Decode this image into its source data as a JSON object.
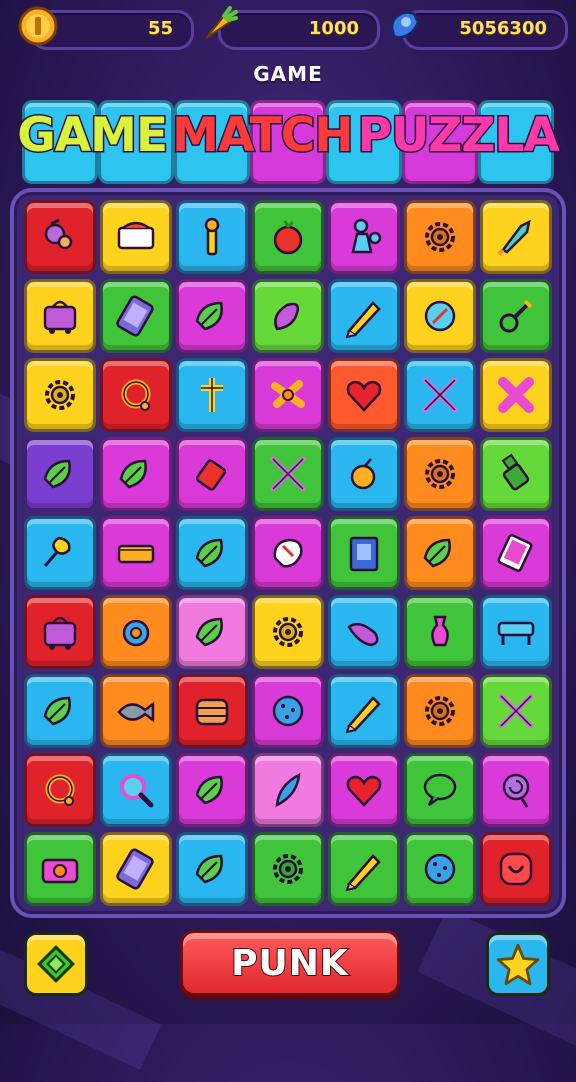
{
  "resources": [
    {
      "icon": "coin-icon",
      "value": "55"
    },
    {
      "icon": "carrot-icon",
      "value": "1000"
    },
    {
      "icon": "gem-icon",
      "value": "5056300"
    }
  ],
  "header": {
    "subtitle": "GAME"
  },
  "title": {
    "words": [
      {
        "text": "GAME",
        "color": "#d9f23a"
      },
      {
        "text": "MATCH",
        "color": "#ff3a3a"
      },
      {
        "text": "PUZZLA",
        "color": "#ff3aa8"
      }
    ]
  },
  "banner_colors": [
    "#2ec4f0",
    "#2ec4f0",
    "#2ec4f0",
    "#d63adb",
    "#2ec4f0",
    "#d63adb",
    "#2ec4f0"
  ],
  "board": {
    "rows": [
      [
        {
          "c": "#e0232a",
          "i": "berry"
        },
        {
          "c": "#ffd21e",
          "i": "box"
        },
        {
          "c": "#2ab6ef",
          "i": "torch"
        },
        {
          "c": "#3fc43a",
          "i": "tomato"
        },
        {
          "c": "#d93ad8",
          "i": "figure"
        },
        {
          "c": "#ff8a1e",
          "i": "gear"
        },
        {
          "c": "#ffd21e",
          "i": "rocket"
        }
      ],
      [
        {
          "c": "#ffd21e",
          "i": "bag"
        },
        {
          "c": "#3fc43a",
          "i": "phone"
        },
        {
          "c": "#d93ad8",
          "i": "leaf"
        },
        {
          "c": "#66d93a",
          "i": "eggplant"
        },
        {
          "c": "#2ab6ef",
          "i": "pencil"
        },
        {
          "c": "#ffd21e",
          "i": "compass"
        },
        {
          "c": "#3fc43a",
          "i": "key"
        }
      ],
      [
        {
          "c": "#ffd21e",
          "i": "gear"
        },
        {
          "c": "#e0232a",
          "i": "ring"
        },
        {
          "c": "#2ab6ef",
          "i": "cross"
        },
        {
          "c": "#d93ad8",
          "i": "bow"
        },
        {
          "c": "#ff5a2e",
          "i": "heart"
        },
        {
          "c": "#2ab6ef",
          "i": "swords"
        },
        {
          "c": "#ffd21e",
          "i": "x"
        }
      ],
      [
        {
          "c": "#7a3ed0",
          "i": "leaf"
        },
        {
          "c": "#d93ad8",
          "i": "leaf"
        },
        {
          "c": "#d93ad8",
          "i": "tag"
        },
        {
          "c": "#3fc43a",
          "i": "swords"
        },
        {
          "c": "#2ab6ef",
          "i": "apple"
        },
        {
          "c": "#ff8a1e",
          "i": "gear"
        },
        {
          "c": "#66d93a",
          "i": "bottle"
        }
      ],
      [
        {
          "c": "#2ab6ef",
          "i": "pin"
        },
        {
          "c": "#d93ad8",
          "i": "bar"
        },
        {
          "c": "#2ab6ef",
          "i": "leaf"
        },
        {
          "c": "#d93ad8",
          "i": "glove"
        },
        {
          "c": "#3fc43a",
          "i": "book"
        },
        {
          "c": "#ff8a1e",
          "i": "leaf"
        },
        {
          "c": "#d93ad8",
          "i": "card"
        }
      ],
      [
        {
          "c": "#e0232a",
          "i": "bag"
        },
        {
          "c": "#ff8a1e",
          "i": "donut"
        },
        {
          "c": "#f07ae0",
          "i": "leaf"
        },
        {
          "c": "#ffd21e",
          "i": "gear"
        },
        {
          "c": "#2ab6ef",
          "i": "pepper"
        },
        {
          "c": "#3fc43a",
          "i": "potion"
        },
        {
          "c": "#2ab6ef",
          "i": "bench"
        }
      ],
      [
        {
          "c": "#2ab6ef",
          "i": "leaf"
        },
        {
          "c": "#ff8a1e",
          "i": "fish"
        },
        {
          "c": "#e0232a",
          "i": "burger"
        },
        {
          "c": "#d93ad8",
          "i": "ball"
        },
        {
          "c": "#2ab6ef",
          "i": "pencil"
        },
        {
          "c": "#ff8a1e",
          "i": "gear"
        },
        {
          "c": "#66d93a",
          "i": "swords"
        }
      ],
      [
        {
          "c": "#e0232a",
          "i": "ring"
        },
        {
          "c": "#2ab6ef",
          "i": "magnifier"
        },
        {
          "c": "#d93ad8",
          "i": "leaf"
        },
        {
          "c": "#f07ae0",
          "i": "feather"
        },
        {
          "c": "#d93ad8",
          "i": "heart"
        },
        {
          "c": "#3fc43a",
          "i": "bubble"
        },
        {
          "c": "#d93ad8",
          "i": "spiral"
        }
      ],
      [
        {
          "c": "#3fc43a",
          "i": "camera"
        },
        {
          "c": "#ffd21e",
          "i": "phone"
        },
        {
          "c": "#2ab6ef",
          "i": "leaf"
        },
        {
          "c": "#3fc43a",
          "i": "gear"
        },
        {
          "c": "#3fc43a",
          "i": "pencil"
        },
        {
          "c": "#3fc43a",
          "i": "ball"
        },
        {
          "c": "#e0232a",
          "i": "face"
        }
      ]
    ]
  },
  "bottom": {
    "left_button_icon": "cube-icon",
    "play_label": "PUNK",
    "right_button_icon": "star-icon",
    "left_color": "#ffd21e",
    "right_color": "#2ab6ef"
  }
}
